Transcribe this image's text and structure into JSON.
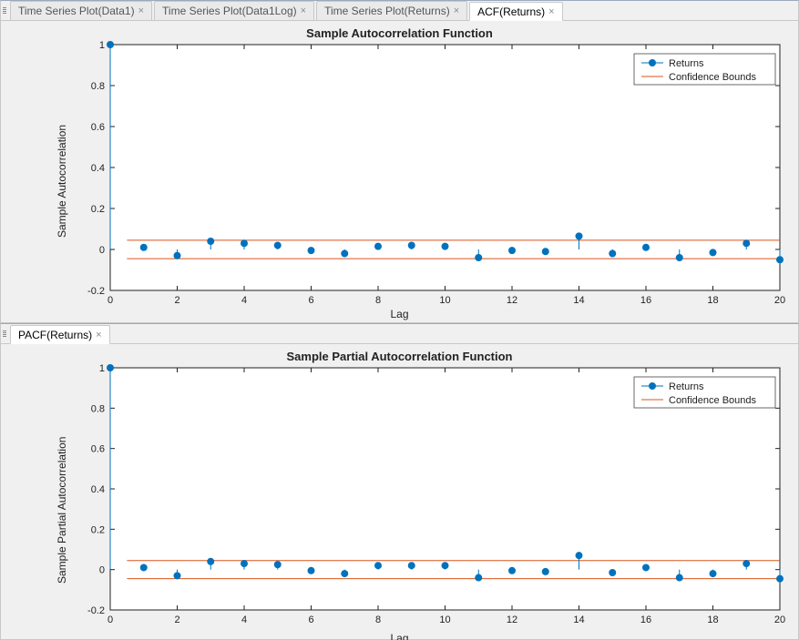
{
  "tabs_top": [
    {
      "label": "Time Series Plot(Data1)",
      "active": false
    },
    {
      "label": "Time Series Plot(Data1Log)",
      "active": false
    },
    {
      "label": "Time Series Plot(Returns)",
      "active": false
    },
    {
      "label": "ACF(Returns)",
      "active": true
    }
  ],
  "tabs_bot": [
    {
      "label": "PACF(Returns)",
      "active": true
    }
  ],
  "legend_returns": "Returns",
  "legend_conf": "Confidence Bounds",
  "chart_data": [
    {
      "type": "stem",
      "title": "Sample Autocorrelation Function",
      "xlabel": "Lag",
      "ylabel": "Sample Autocorrelation",
      "xlim": [
        0,
        20
      ],
      "ylim": [
        -0.2,
        1.0
      ],
      "xticks": [
        0,
        2,
        4,
        6,
        8,
        10,
        12,
        14,
        16,
        18,
        20
      ],
      "yticks": [
        -0.2,
        0,
        0.2,
        0.4,
        0.6,
        0.8,
        1.0
      ],
      "confidence": 0.045,
      "x": [
        0,
        1,
        2,
        3,
        4,
        5,
        6,
        7,
        8,
        9,
        10,
        11,
        12,
        13,
        14,
        15,
        16,
        17,
        18,
        19,
        20
      ],
      "y": [
        1.0,
        0.01,
        -0.03,
        0.04,
        0.03,
        0.02,
        -0.005,
        -0.02,
        0.015,
        0.02,
        0.015,
        -0.04,
        -0.005,
        -0.01,
        0.065,
        -0.02,
        0.01,
        -0.04,
        -0.015,
        0.03,
        -0.05
      ],
      "series_name": "Returns"
    },
    {
      "type": "stem",
      "title": "Sample Partial Autocorrelation Function",
      "xlabel": "Lag",
      "ylabel": "Sample Partial Autocorrelation",
      "xlim": [
        0,
        20
      ],
      "ylim": [
        -0.2,
        1.0
      ],
      "xticks": [
        0,
        2,
        4,
        6,
        8,
        10,
        12,
        14,
        16,
        18,
        20
      ],
      "yticks": [
        -0.2,
        0,
        0.2,
        0.4,
        0.6,
        0.8,
        1.0
      ],
      "confidence": 0.045,
      "x": [
        0,
        1,
        2,
        3,
        4,
        5,
        6,
        7,
        8,
        9,
        10,
        11,
        12,
        13,
        14,
        15,
        16,
        17,
        18,
        19,
        20
      ],
      "y": [
        1.0,
        0.01,
        -0.03,
        0.04,
        0.03,
        0.025,
        -0.005,
        -0.02,
        0.02,
        0.02,
        0.02,
        -0.04,
        -0.005,
        -0.01,
        0.07,
        -0.015,
        0.01,
        -0.04,
        -0.02,
        0.03,
        -0.045
      ],
      "series_name": "Returns"
    }
  ]
}
